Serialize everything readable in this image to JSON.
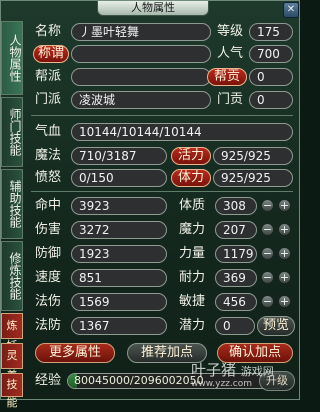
{
  "window": {
    "title": "人物属性",
    "close_glyph": "✕"
  },
  "tabs": [
    {
      "label": "人物属性",
      "active": true
    },
    {
      "label": "师门技能",
      "active": false
    },
    {
      "label": "辅助技能",
      "active": false
    },
    {
      "label": "修炼技能",
      "active": false
    },
    {
      "label": "炼妖",
      "active": false
    },
    {
      "label": "灵养",
      "active": false
    },
    {
      "label": "技能",
      "active": false
    }
  ],
  "basic": {
    "name_label": "名称",
    "name_value": "丿墨叶轻舞",
    "level_label": "等级",
    "level_value": "175",
    "title_button": "称谓",
    "title_value": "",
    "popularity_label": "人气",
    "popularity_value": "700",
    "guild_label": "帮派",
    "guild_value": "",
    "guild_contrib_button": "帮贡",
    "guild_contrib_value": "0",
    "school_label": "门派",
    "school_value": "凌波城",
    "school_contrib_label": "门贡",
    "school_contrib_value": "0"
  },
  "vitals": {
    "hp_label": "气血",
    "hp_value": "10144/10144/10144",
    "mp_label": "魔法",
    "mp_value": "710/3187",
    "vitality_button": "活力",
    "vitality_value": "925/925",
    "rage_label": "愤怒",
    "rage_value": "0/150",
    "stamina_button": "体力",
    "stamina_value": "925/925"
  },
  "stats": [
    {
      "label": "命中",
      "value": "3923"
    },
    {
      "label": "伤害",
      "value": "3272"
    },
    {
      "label": "防御",
      "value": "1923"
    },
    {
      "label": "速度",
      "value": "851"
    },
    {
      "label": "法伤",
      "value": "1569"
    },
    {
      "label": "法防",
      "value": "1367"
    }
  ],
  "attributes": [
    {
      "label": "体质",
      "value": "308"
    },
    {
      "label": "魔力",
      "value": "207"
    },
    {
      "label": "力量",
      "value": "1179"
    },
    {
      "label": "耐力",
      "value": "369"
    },
    {
      "label": "敏捷",
      "value": "456"
    }
  ],
  "potential": {
    "label": "潜力",
    "value": "0",
    "preview_button": "预览"
  },
  "stepper": {
    "minus": "−",
    "plus": "+"
  },
  "buttons": {
    "more_attrs": "更多属性",
    "recommend": "推荐加点",
    "confirm": "确认加点"
  },
  "experience": {
    "label": "经验",
    "value": "80045000/2096002050",
    "upgrade_button": "升级",
    "fraction": 0.04
  },
  "watermark": {
    "line1": "叶子猪",
    "line2": "游戏网",
    "line3": "www.yzz.com"
  }
}
